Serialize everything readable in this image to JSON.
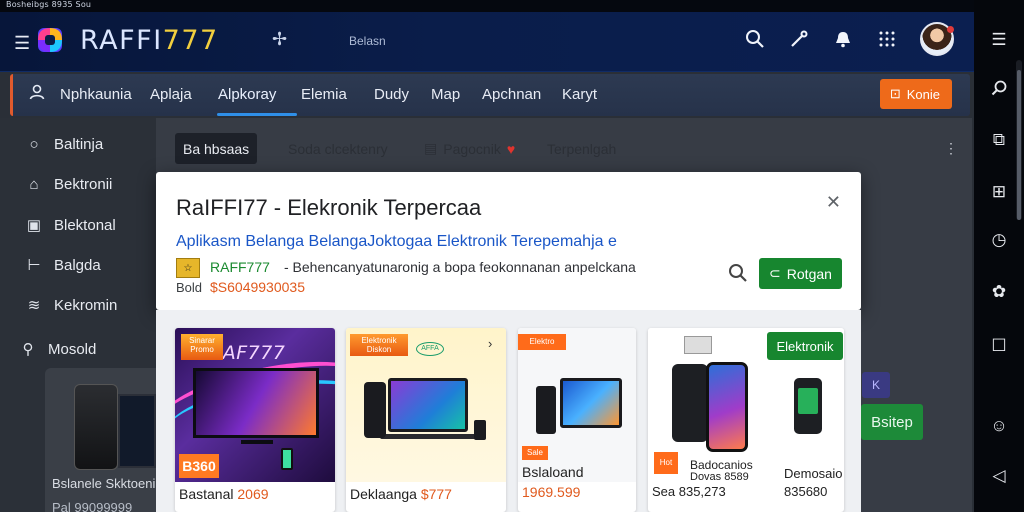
{
  "statusbar": {
    "left_text": "Bosheibgs 8935 Sou"
  },
  "topbar": {
    "brand_name": "RAFFI",
    "brand_num": "777",
    "caption": "Belasn"
  },
  "icons": {
    "hamburger": "menu-icon",
    "search": "search-icon",
    "tool": "tool-icon",
    "bell": "bell-icon",
    "apps": "apps-grid-icon"
  },
  "catnav": {
    "items": [
      "Nphkaunia",
      "Aplaja",
      "Alpkoray",
      "Elemia",
      "Dudy",
      "Map",
      "Apchnan",
      "Karyt"
    ],
    "active_index": 2,
    "cta_label": "Konie"
  },
  "sidebar": {
    "items": [
      "Baltinja",
      "Bektronii",
      "Blektonal",
      "Balgda",
      "Kekromin",
      "Mosold"
    ],
    "caption": "Bslanele Skktoenir",
    "price": "Pal 99099999"
  },
  "main": {
    "chip_dark": "Ba hbsaas",
    "chip_2": "Soda clcektenry",
    "chip_3": "Pagocnik",
    "chip_4": "Terpenlgah"
  },
  "modal": {
    "title": "RaIFFI77 - Elekronik Terpercaa",
    "subtitle": "Aplikasm Belanga BelangaJoktogaa Elektronik Terepemahja e",
    "badge": "☆",
    "brand": "RAFF777",
    "description": "- Behencanyatunaronig a bopa feokonnanan anpelckana",
    "label": "Bold",
    "number": "$S6049930035",
    "button_label": "Rotgan"
  },
  "cards": [
    {
      "logo": "RAF777",
      "badge": "B360",
      "title": "Bastanal",
      "price": "2069",
      "tag": "Sinarar Promo"
    },
    {
      "tag": "Elektronik Diskon",
      "logo": "AFFA",
      "title": "Deklaanga",
      "price": "$777"
    },
    {
      "tag": "Elektro",
      "mini": "Sale",
      "title": "Bslaloand",
      "price": "1969.599"
    },
    {
      "label": "Elektronik",
      "title": "Badocanios",
      "sub": "Dovas 8589",
      "title2": "Demosaio",
      "price_a": "Sea 835,273",
      "price_b": "835680",
      "mini": "Hot"
    }
  ],
  "side": {
    "green_label": "Bsitep",
    "purple_label": "K"
  },
  "colors": {
    "accent_orange": "#ee6a1a",
    "accent_green": "#17862f",
    "link_blue": "#1a56c7",
    "nav_underline": "#2f8fe8"
  }
}
